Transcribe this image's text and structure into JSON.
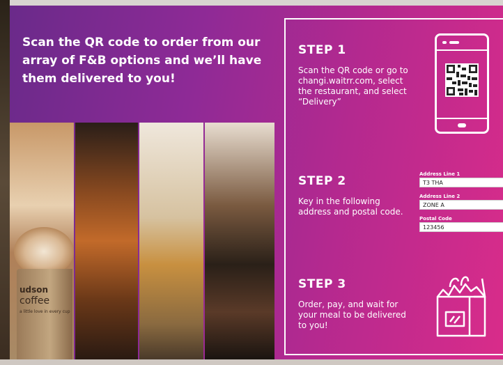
{
  "headline": "Scan the QR code to order from our array of F&B options and we’ll have them delivered to you!",
  "steps": [
    {
      "title": "STEP 1",
      "body": "Scan the QR code or go to changi.waitrr.com, select the restaurant, and select “Delivery”"
    },
    {
      "title": "STEP 2",
      "body": "Key in the following address and postal code."
    },
    {
      "title": "STEP 3",
      "body": "Order, pay, and wait for your meal to be delivered to you!"
    }
  ],
  "address": {
    "line1_label": "Address Line 1",
    "line1_value": "T3 THA",
    "line2_label": "Address Line 2",
    "line2_value": "ZONE A",
    "postal_label": "Postal Code",
    "postal_value": "123456"
  },
  "brand": {
    "name": "udson",
    "sub": "coffee",
    "tagline": "a little love in every cup"
  },
  "colors": {
    "gradient_start": "#6a2a8a",
    "gradient_end": "#d92c8a",
    "text": "#ffffff"
  },
  "icons": [
    "phone-icon",
    "qr-code-icon",
    "shopping-bag-icon"
  ]
}
